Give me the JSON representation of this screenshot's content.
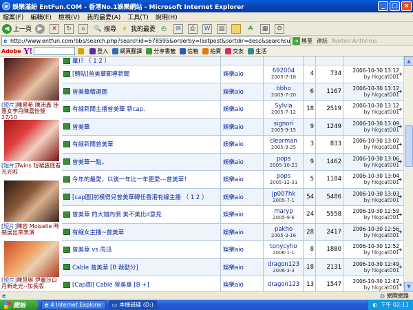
{
  "window": {
    "title": "娛樂滿紛 EntFun.COM - 香港No.1娛樂網站 - Microsoft Internet Explorer",
    "min": "_",
    "max": "□",
    "close": "×"
  },
  "menu": [
    "檔案(F)",
    "編輯(E)",
    "檢視(V)",
    "我的最愛(A)",
    "工具(T)",
    "說明(H)"
  ],
  "toolbar": {
    "back": "上一頁",
    "search": "搜尋",
    "favorites": "我的最愛"
  },
  "address": {
    "url": "http://www.entfun.com/bbs/search.php?searchid=678595&orderby=lastpost&sortdir=desc&searchsubmit=yes&sid=Mg0uqL",
    "go": "移至",
    "links": "連結",
    "norton": "Norton AntiVirus"
  },
  "yahoo": {
    "adobe": "Adobe",
    "logo": "Y!",
    "login": "登入",
    "buttons": [
      "網頁翻譯",
      "分享書籤",
      "信箱",
      "拍賣",
      "交友",
      "生活"
    ]
  },
  "sidebar": {
    "items": [
      {
        "caption_tag": "[短片]",
        "caption": "陳易希 陳沛鑫 佳惠女李丹陳嘉怡獎 27/10"
      },
      {
        "caption_tag": "[短片]",
        "caption": "Twins 短裙露底看光光啦"
      },
      {
        "caption_tag": "[短片]",
        "caption": "陳容 Moiselle 時裝展出來表演"
      },
      {
        "caption_tag": "[短片]",
        "caption": "陳慧琳 伊麗莎白 月新走光--加長版"
      }
    ]
  },
  "rows": [
    {
      "title": "華)? （ 1 2 ）",
      "forum": "",
      "author": "",
      "date": "",
      "replies": "",
      "views": "",
      "last_time": "",
      "last_by": ""
    },
    {
      "title": "[轉貼]曾美華郵導新聞",
      "forum": "娛樂aio",
      "author": "692004",
      "date": "2005-7-18",
      "replies": "4",
      "views": "734",
      "last_time": "2006-10-30 13:12",
      "last_by": "by hkgcat001"
    },
    {
      "title": "曾美華精選圖",
      "forum": "娛樂aio",
      "author": "bbho",
      "date": "2005-7-20",
      "replies": "6",
      "views": "1167",
      "last_time": "2006-10-30 13:12",
      "last_by": "by hkgcat001"
    },
    {
      "title": "有線新聞主播曾美華 新cap.",
      "forum": "娛樂aio",
      "author": "Sylvia",
      "date": "2005-7-12",
      "replies": "18",
      "views": "2519",
      "last_time": "2006-10-30 13:12",
      "last_by": "by hkgcat001"
    },
    {
      "title": "曾美華",
      "forum": "娛樂aio",
      "author": "signori",
      "date": "2005-9-15",
      "replies": "9",
      "views": "1249",
      "last_time": "2006-10-30 13:09",
      "last_by": "by hkgcat001"
    },
    {
      "title": "有線新聞曾美華",
      "forum": "娛樂aio",
      "author": "clearman",
      "date": "2005-9-25",
      "replies": "3",
      "views": "833",
      "last_time": "2006-10-30 13:07",
      "last_by": "by hkgcat001"
    },
    {
      "title": "曾美華一點。",
      "forum": "娛樂aio",
      "author": "pops",
      "date": "2005-10-23",
      "replies": "9",
      "views": "1462",
      "last_time": "2006-10-30 13:06",
      "last_by": "by hkgcat001"
    },
    {
      "title": "今年的最愛，以後一年比一年更愛---曾美華！",
      "forum": "娛樂aio",
      "author": "pops",
      "date": "2005-12-31",
      "replies": "5",
      "views": "1184",
      "last_time": "2006-10-30 13:04",
      "last_by": "by hkgcat001"
    },
    {
      "title": "[cap圖]前模得兒曾美華轉任香港有線主播 （ 1 2 ）",
      "forum": "娛樂aio",
      "author": "jp007hk",
      "date": "2005-7-1",
      "replies": "54",
      "views": "5486",
      "last_time": "2006-10-30 13:03",
      "last_by": "by hkgcat001"
    },
    {
      "title": "曾美華 的大錯內側 美不美比d意見",
      "forum": "娛樂aio",
      "author": "maryp",
      "date": "2005-9-6",
      "replies": "24",
      "views": "5558",
      "last_time": "2006-10-30 12:59",
      "last_by": "by hkgcat001"
    },
    {
      "title": "有線女主播~曾美華",
      "forum": "娛樂aio",
      "author": "pakho",
      "date": "2005-3-16",
      "replies": "28",
      "views": "2417",
      "last_time": "2006-10-30 12:56",
      "last_by": "by hkgcat001"
    },
    {
      "title": "曾美華 vs 周迅",
      "forum": "娛樂aio",
      "author": "tonycyho",
      "date": "2006-1-1",
      "replies": "8",
      "views": "1880",
      "last_time": "2006-10-30 12:52",
      "last_by": "by hkgcat001"
    },
    {
      "title": "Cable 曾美華 [B 裁勸分]",
      "forum": "娛樂aio",
      "author": "dragon123",
      "date": "2006-3-3",
      "replies": "18",
      "views": "2131",
      "last_time": "2006-10-30 12:49",
      "last_by": "by hkgcat001"
    },
    {
      "title": "[Cap圖] Cable 曾美華 [B +]",
      "forum": "娛樂aio",
      "author": "dragon123",
      "date": "",
      "replies": "13",
      "views": "1547",
      "last_time": "2006-10-30 12:47",
      "last_by": "by hkgcat001"
    }
  ],
  "status": {
    "zone": "網際網路"
  },
  "taskbar": {
    "start": "開始",
    "tasks": [
      "4 Internet Explorer",
      "本機磁碟 (D:)"
    ],
    "clock": "下午 02:11"
  }
}
